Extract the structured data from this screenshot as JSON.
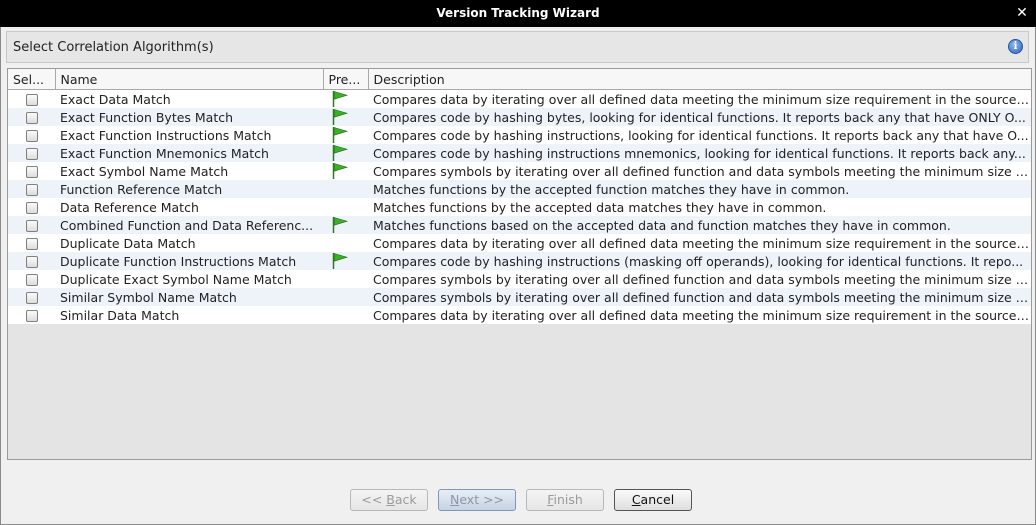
{
  "window": {
    "title": "Version Tracking Wizard",
    "close_glyph": "✕"
  },
  "panel": {
    "title": "Select Correlation Algorithm(s)",
    "info_glyph": "i"
  },
  "table": {
    "headers": {
      "select": "Sel...",
      "name": "Name",
      "preferred": "Pre...",
      "description": "Description"
    },
    "rows": [
      {
        "name": "Exact Data Match",
        "preferred": true,
        "description": "Compares data by iterating over all defined data meeting the minimum size requirement in the source ..."
      },
      {
        "name": "Exact Function Bytes Match",
        "preferred": true,
        "description": "Compares code by hashing bytes, looking for identical functions. It reports back any that have ONLY O..."
      },
      {
        "name": "Exact Function Instructions Match",
        "preferred": true,
        "description": "Compares code by hashing instructions, looking for identical functions. It reports back any that have O..."
      },
      {
        "name": "Exact Function Mnemonics Match",
        "preferred": true,
        "description": "Compares code by hashing instructions mnemonics, looking for identical functions. It reports back any..."
      },
      {
        "name": "Exact Symbol Name Match",
        "preferred": true,
        "description": "Compares symbols by iterating over all defined function and data symbols meeting the minimum size r..."
      },
      {
        "name": "Function Reference Match",
        "preferred": false,
        "description": "Matches functions by the accepted function matches they have in common."
      },
      {
        "name": "Data Reference Match",
        "preferred": false,
        "description": "Matches functions by the accepted data matches they have in common."
      },
      {
        "name": "Combined Function and Data Referenc...",
        "preferred": true,
        "description": "Matches functions based on the accepted data and function matches they have in common."
      },
      {
        "name": "Duplicate Data Match",
        "preferred": false,
        "description": "Compares data by iterating over all defined data meeting the minimum size requirement in the source ..."
      },
      {
        "name": "Duplicate Function Instructions Match",
        "preferred": true,
        "description": "Compares code by hashing instructions (masking off operands), looking for identical functions.  It repo..."
      },
      {
        "name": "Duplicate Exact Symbol Name Match",
        "preferred": false,
        "description": "Compares symbols by iterating over all defined function and data symbols meeting the minimum size r..."
      },
      {
        "name": "Similar Symbol Name Match",
        "preferred": false,
        "description": "Compares symbols by iterating over all defined function and data symbols meeting the minimum size r..."
      },
      {
        "name": "Similar Data Match",
        "preferred": false,
        "description": "Compares data by iterating over all defined data meeting the minimum size requirement in the source ..."
      }
    ]
  },
  "buttons": {
    "back": {
      "pre": "<< ",
      "mnemonic": "B",
      "post": "ack"
    },
    "next": {
      "pre": "",
      "mnemonic": "N",
      "post": "ext >>"
    },
    "finish": {
      "pre": "",
      "mnemonic": "F",
      "post": "inish"
    },
    "cancel": {
      "pre": "",
      "mnemonic": "C",
      "post": "ancel"
    }
  },
  "colors": {
    "flag": "#3fae2a",
    "titlebar": "#000000",
    "row_alt": "#eef3fa"
  }
}
